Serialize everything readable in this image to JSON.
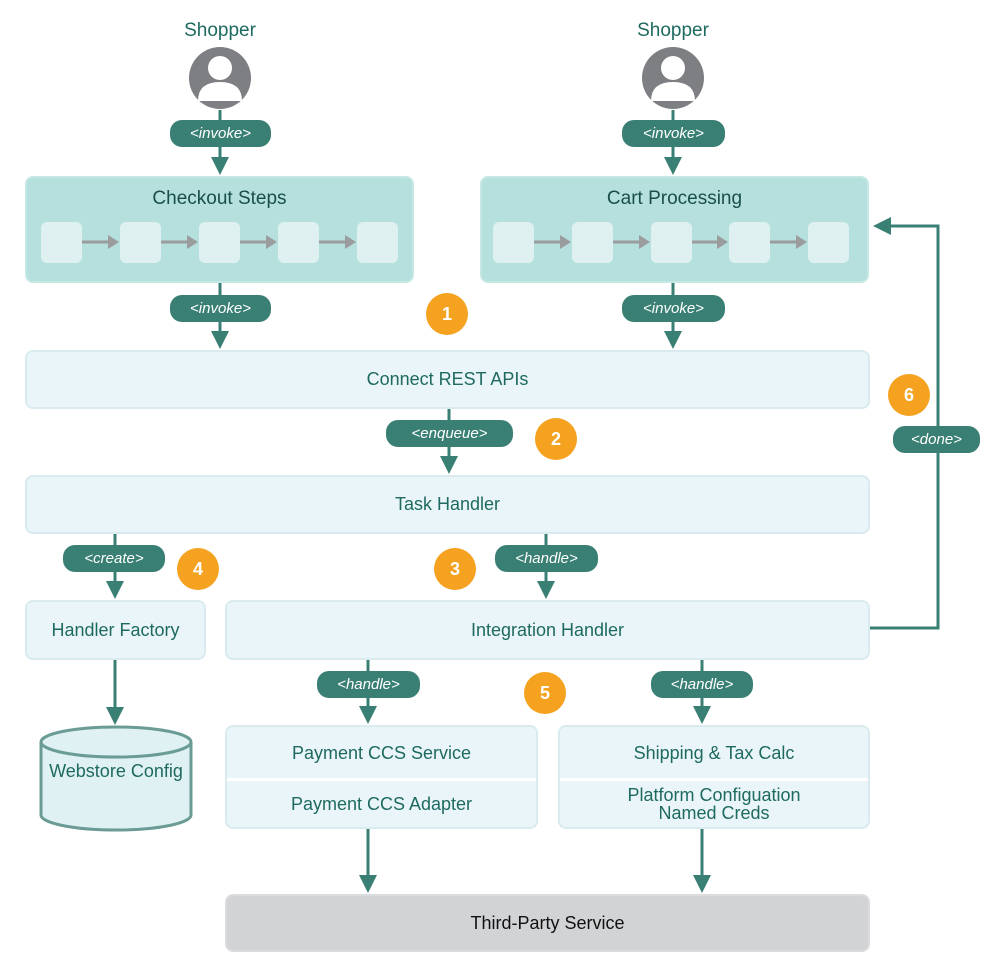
{
  "colors": {
    "teal": "#3a7f74",
    "text": "#1e6a60",
    "box": "#eaf5f9",
    "cyan": "#b5e0dd",
    "badge": "#f4a21f",
    "gray": "#d2d3d5"
  },
  "actors": [
    {
      "label": "Shopper",
      "icon": "user-icon"
    },
    {
      "label": "Shopper",
      "icon": "user-icon"
    }
  ],
  "connectors": {
    "invoke": "<invoke>",
    "enqueue": "<enqueue>",
    "create": "<create>",
    "handle": "<handle>",
    "done": "<done>"
  },
  "boxes": {
    "checkout": "Checkout Steps",
    "cart": "Cart Processing",
    "connect": "Connect REST APIs",
    "task": "Task Handler",
    "factory": "Handler Factory",
    "integration": "Integration Handler",
    "webstore": "Webstore Config",
    "payment_service": "Payment CCS Service",
    "payment_adapter": "Payment CCS Adapter",
    "shipping": "Shipping & Tax Calc",
    "platform": "Platform Configuation Named Creds",
    "third_party": "Third-Party Service"
  },
  "badges": [
    "1",
    "2",
    "3",
    "4",
    "5",
    "6"
  ]
}
